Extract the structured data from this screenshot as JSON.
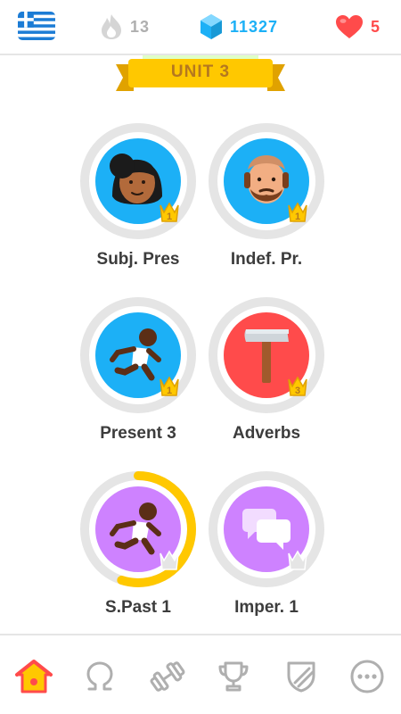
{
  "header": {
    "flag_icon": "greek-flag-icon",
    "streak": {
      "icon": "flame-icon",
      "value": "13"
    },
    "gems": {
      "icon": "gem-icon",
      "value": "11327"
    },
    "hearts": {
      "icon": "heart-icon",
      "value": "5"
    }
  },
  "unit": {
    "title": "UNIT 3"
  },
  "skills": [
    {
      "name": "Subj. Pres",
      "icon": "woman-face-icon",
      "crown_level": "1",
      "color": "#1cb0f6"
    },
    {
      "name": "Indef. Pr.",
      "icon": "bearded-man-face-icon",
      "crown_level": "1",
      "color": "#1cb0f6"
    },
    {
      "name": "Present 3",
      "icon": "running-person-icon",
      "crown_level": "1",
      "color": "#1cb0f6"
    },
    {
      "name": "Adverbs",
      "icon": "hammer-icon",
      "crown_level": "3",
      "color": "#ff4b4b"
    },
    {
      "name": "S.Past 1",
      "icon": "running-person-icon",
      "crown_level": "",
      "progress": 0.55,
      "color": "#ce82ff"
    },
    {
      "name": "Imper. 1",
      "icon": "speech-bubbles-icon",
      "crown_level": "",
      "color": "#ce82ff"
    }
  ],
  "nav": [
    {
      "name": "learn",
      "icon": "home-icon",
      "active": true
    },
    {
      "name": "stories",
      "icon": "omega-icon",
      "active": false
    },
    {
      "name": "practice",
      "icon": "dumbbell-icon",
      "active": false
    },
    {
      "name": "leaderboards",
      "icon": "trophy-icon",
      "active": false
    },
    {
      "name": "shop",
      "icon": "shield-icon",
      "active": false
    },
    {
      "name": "more",
      "icon": "more-icon",
      "active": false
    }
  ],
  "colors": {
    "gold": "#ffc800",
    "gold_dark": "#e0a200",
    "gray_ring": "#e5e5e5",
    "text": "#3c3c3c",
    "blue": "#1cb0f6",
    "red": "#ff4b4b",
    "purple": "#ce82ff"
  }
}
